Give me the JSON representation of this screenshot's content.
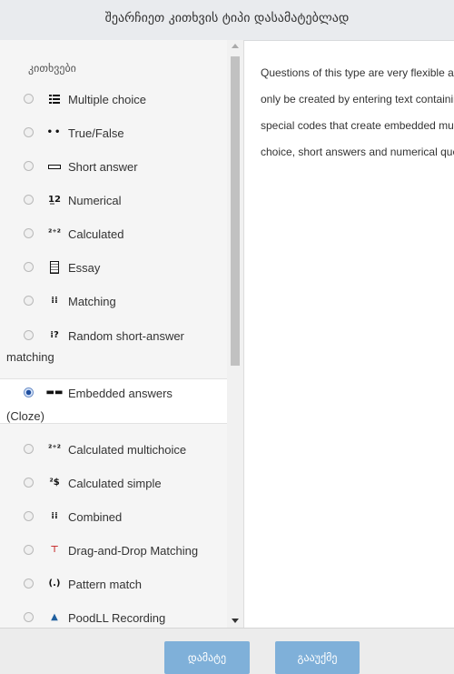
{
  "dialog": {
    "title": "შეარჩიეთ კითხვის ტიპი დასამატებლად"
  },
  "category": "კითხვები",
  "items": [
    {
      "label": "Multiple choice",
      "icon": "multiple-choice-icon",
      "selected": false
    },
    {
      "label": "True/False",
      "icon": "true-false-icon",
      "selected": false
    },
    {
      "label": "Short answer",
      "icon": "short-answer-icon",
      "selected": false
    },
    {
      "label": "Numerical",
      "icon": "numerical-icon",
      "selected": false
    },
    {
      "label": "Calculated",
      "icon": "calculated-icon",
      "selected": false
    },
    {
      "label": "Essay",
      "icon": "essay-icon",
      "selected": false
    },
    {
      "label": "Matching",
      "icon": "matching-icon",
      "selected": false
    },
    {
      "label": "Random short-answer matching",
      "icon": "random-short-answer-icon",
      "selected": false
    },
    {
      "label": "Embedded answers (Cloze)",
      "icon": "embedded-answers-icon",
      "selected": true
    },
    {
      "label": "Calculated multichoice",
      "icon": "calculated-multichoice-icon",
      "selected": false
    },
    {
      "label": "Calculated simple",
      "icon": "calculated-simple-icon",
      "selected": false
    },
    {
      "label": "Combined",
      "icon": "combined-icon",
      "selected": false
    },
    {
      "label": "Drag-and-Drop Matching",
      "icon": "drag-drop-icon",
      "selected": false
    },
    {
      "label": "Pattern match",
      "icon": "pattern-match-icon",
      "selected": false
    },
    {
      "label": "PoodLL Recording",
      "icon": "poodll-icon",
      "selected": false
    }
  ],
  "glyphs": {
    "numerical": "1̲2",
    "calculated": "²⁺²",
    "matching": "⁞⁞",
    "random": "⁞?",
    "embedded": "▬▬",
    "calc_multichoice": "²⁺²",
    "calc_simple": "²$",
    "combined": "⁞⁞",
    "dragdrop": "⊤",
    "pattern": "(.)",
    "poodll": "▲"
  },
  "description_lines": [
    "Questions of this type are very flexible and can",
    "only be created by entering text containing",
    "special codes that create embedded multiple",
    "choice, short answers and numerical questions."
  ],
  "buttons": {
    "add": "დამატე",
    "cancel": "გააუქმე"
  }
}
